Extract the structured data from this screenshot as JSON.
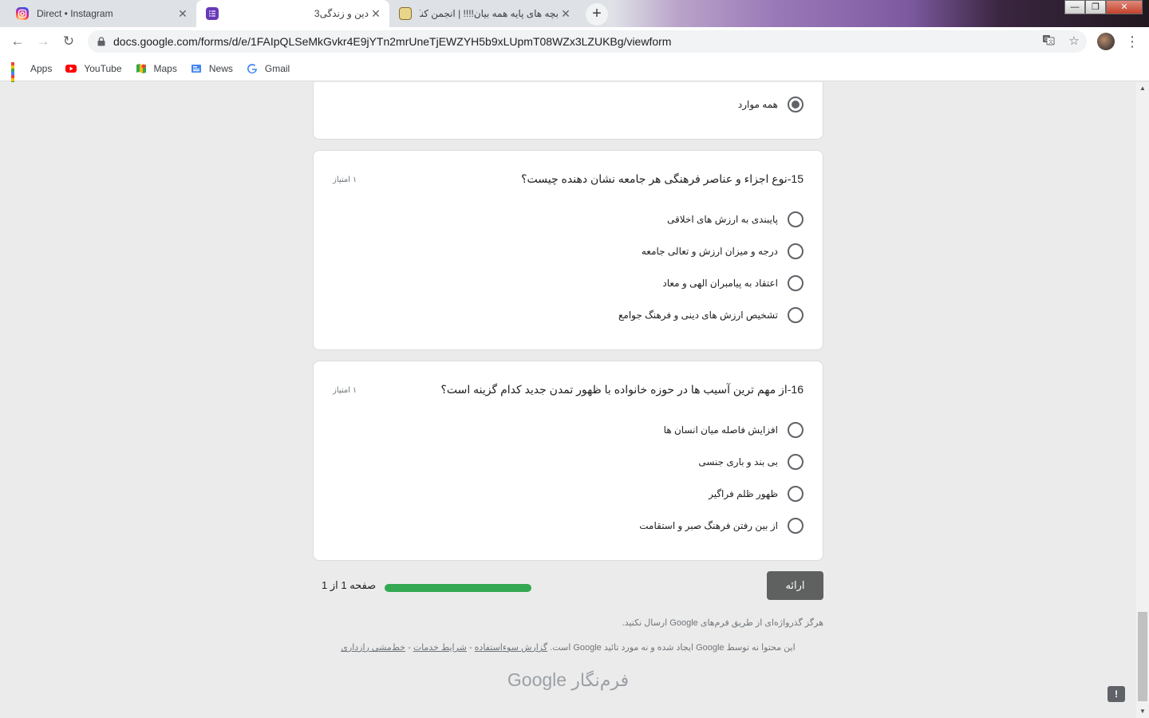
{
  "browser": {
    "tabs": [
      {
        "title": "Direct • Instagram",
        "icon": "instagram-icon"
      },
      {
        "title": "دین و زندگی3",
        "icon": "google-forms-icon"
      },
      {
        "title": "بچه های پایه همه بیان!!!! | انجمن کنکوری ر",
        "icon": "forum-icon"
      }
    ],
    "new_tab": "+",
    "url": "docs.google.com/forms/d/e/1FAIpQLSeMkGvkr4E9jYTn2mrUneTjEWZYH5b9xLUpmT08WZx3LZUKBg/viewform",
    "bookmarks": [
      {
        "label": "Apps",
        "icon": "apps-grid-icon"
      },
      {
        "label": "YouTube",
        "icon": "youtube-icon"
      },
      {
        "label": "Maps",
        "icon": "maps-icon"
      },
      {
        "label": "News",
        "icon": "news-icon"
      },
      {
        "label": "Gmail",
        "icon": "google-icon"
      }
    ]
  },
  "form": {
    "prev_option": {
      "label": "همه موارد",
      "checked": true
    },
    "questions": [
      {
        "title": "15-نوع اجزاء و عناصر فرهنگی هر جامعه نشان دهنده چیست؟",
        "points": "۱ امتیاز",
        "options": [
          "پایبندی به ارزش های اخلاقی",
          "درجه و میزان ارزش و تعالی جامعه",
          "اعتقاد به پیامبران الهی و معاد",
          "تشخیص ارزش های دینی و فرهنگ جوامع"
        ]
      },
      {
        "title": "16-از مهم ترین آسیب ها در حوزه خانواده با ظهور تمدن جدید کدام گزینه است؟",
        "points": "۱ امتیاز",
        "options": [
          "افزایش فاصله میان انسان ها",
          "بی بند و باری جنسی",
          "ظهور ظلم فراگیر",
          "از بین رفتن فرهنگ صبر و استقامت"
        ]
      }
    ],
    "submit_label": "ارائه",
    "progress_fraction": 1.0,
    "page_label": "صفحه 1 از 1",
    "warning": "هرگز گذرواژه‌ای از طریق فرم‌های Google ارسال نکنید.",
    "disclaimer": {
      "text": "این محتوا نه توسط Google ایجاد شده و نه مورد تائید Google است.",
      "link_report": "گزارش سوءاستفاده",
      "link_terms": "شرایط خدمات",
      "link_privacy": "خط‌مشی رازداری",
      "separator": " - "
    },
    "brand": {
      "google": "Google",
      "product": "فرم‌نگار"
    }
  }
}
